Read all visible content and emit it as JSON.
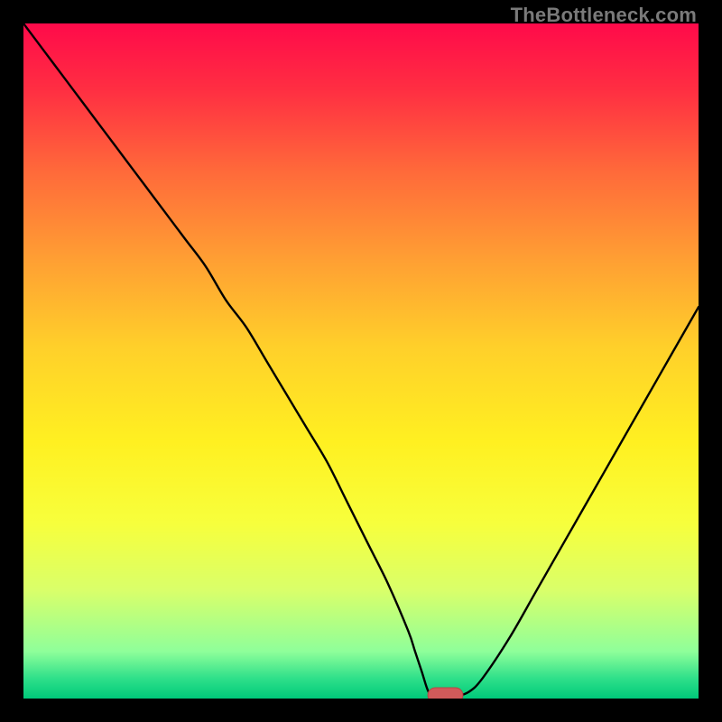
{
  "watermark": "TheBottleneck.com",
  "colors": {
    "frame": "#000000",
    "curve": "#000000",
    "marker_fill": "#d15a5a",
    "marker_stroke": "#b84545",
    "gradient_stops": [
      "#ff0a4a",
      "#ff2f42",
      "#ff6a3a",
      "#ff9f33",
      "#ffd02a",
      "#fff021",
      "#f7ff3c",
      "#d9ff6a",
      "#8fff9a",
      "#2fe08a",
      "#00c97a"
    ]
  },
  "chart_data": {
    "type": "line",
    "title": "",
    "xlabel": "",
    "ylabel": "",
    "xlim": [
      0,
      100
    ],
    "ylim": [
      0,
      100
    ],
    "x": [
      0,
      3,
      6,
      9,
      12,
      15,
      18,
      21,
      24,
      27,
      30,
      33,
      36,
      39,
      42,
      45,
      48,
      51,
      54,
      57,
      58,
      59,
      60,
      61,
      62,
      63,
      64,
      66,
      68,
      72,
      76,
      80,
      84,
      88,
      92,
      96,
      100
    ],
    "values": [
      100,
      96,
      92,
      88,
      84,
      80,
      76,
      72,
      68,
      64,
      59,
      55,
      50,
      45,
      40,
      35,
      29,
      23,
      17,
      10,
      7,
      4,
      1,
      0,
      0,
      0,
      0,
      1,
      3,
      9,
      16,
      23,
      30,
      37,
      44,
      51,
      58
    ],
    "marker": {
      "x": 62.5,
      "y": 0.5,
      "rx": 2.6,
      "ry": 1.1,
      "note": "optimum point"
    }
  }
}
